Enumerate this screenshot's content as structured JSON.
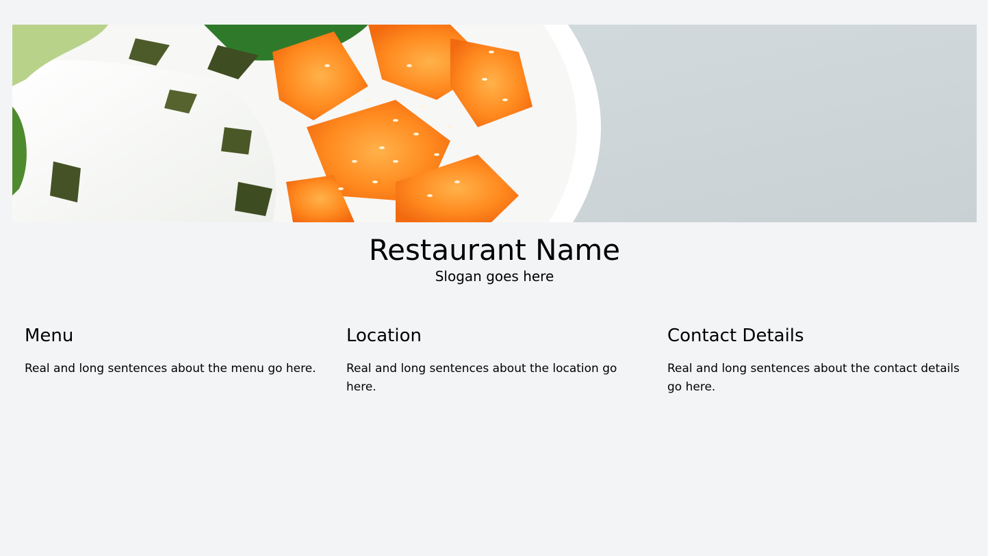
{
  "header": {
    "title": "Restaurant Name",
    "slogan": "Slogan goes here"
  },
  "sections": [
    {
      "heading": "Menu",
      "text": "Real and long sentences about the menu go here."
    },
    {
      "heading": "Location",
      "text": "Real and long sentences about the location go here."
    },
    {
      "heading": "Contact Details",
      "text": "Real and long sentences about the contact details go here."
    }
  ],
  "colors": {
    "background": "#f3f4f6",
    "text": "#000000"
  }
}
